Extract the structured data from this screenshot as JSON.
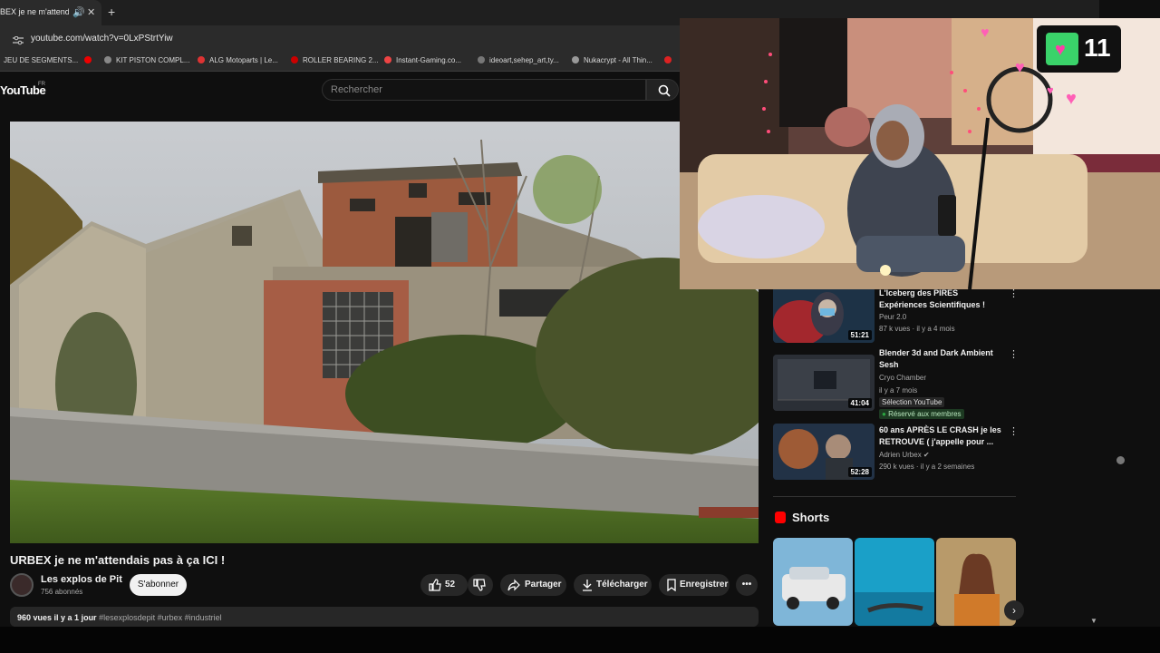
{
  "browser": {
    "tab_title": "BEX je ne m'attendais",
    "url": "youtube.com/watch?v=0LxPStrtYiw",
    "bookmarks": [
      "JEU DE SEGMENTS...",
      "KIT PISTON COMPL...",
      "ALG Motoparts | Le...",
      "ROLLER BEARING 2...",
      "Instant-Gaming.co...",
      "ideoart,sehep_art,ty...",
      "Nukacrypt - All Thin..."
    ]
  },
  "header": {
    "logo": "YouTube",
    "region": "FR",
    "search_placeholder": "Rechercher"
  },
  "video": {
    "title": "URBEX je ne m'attendais pas à ça ICI !",
    "channel": "Les explos de Pit",
    "subscribers": "756 abonnés",
    "subscribe_label": "S'abonner",
    "likes": "52",
    "share_label": "Partager",
    "download_label": "Télécharger",
    "save_label": "Enregistrer",
    "views": "960 vues",
    "date": "il y a 1 jour",
    "hashtags": "#lesexplosdepit #urbex #industriel"
  },
  "sidebar": {
    "items": [
      {
        "title_line1": "L'Iceberg des PIRES",
        "title_line2": "Expériences Scientifiques !",
        "channel": "Peur 2.0",
        "meta": "87 k vues · il y a 4 mois",
        "duration": "51:21"
      },
      {
        "title_line1": "Blender 3d and Dark Ambient",
        "title_line2": "Sesh",
        "channel": "Cryo Chamber",
        "meta": "il y a 7 mois",
        "duration": "41:04",
        "badge1": "Sélection YouTube",
        "badge2": "Réservé aux membres"
      },
      {
        "title_line1": "60 ans APRÈS LE CRASH je les",
        "title_line2": "RETROUVE ( j'appelle pour ...",
        "channel": "Adrien Urbex",
        "meta": "290 k vues · il y a 2 semaines",
        "duration": "52:28"
      }
    ],
    "shorts_title": "Shorts"
  },
  "overlay": {
    "hearts_count": "11"
  },
  "colors": {
    "background": "#0f0f0f",
    "accent_red": "#ff0000",
    "member_green": "#2ba640"
  }
}
